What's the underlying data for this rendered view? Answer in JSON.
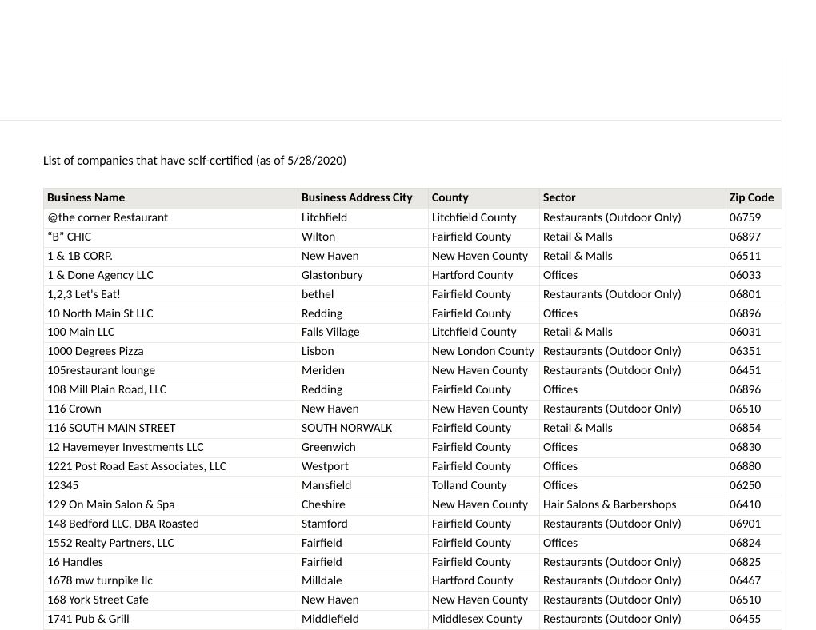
{
  "title": "List of companies that have self-certified (as of 5/28/2020)",
  "columns": {
    "name": "Business Name",
    "city": "Business Address City",
    "county": "County",
    "sector": "Sector",
    "zip": "Zip Code"
  },
  "rows": [
    {
      "name": "@the corner Restaurant",
      "city": "Litchfield",
      "county": "Litchfield County",
      "sector": "Restaurants (Outdoor Only)",
      "zip": "06759"
    },
    {
      "name": "“B” CHIC",
      "city": "Wilton",
      "county": "Fairfield County",
      "sector": "Retail & Malls",
      "zip": "06897"
    },
    {
      "name": "1 & 1B CORP.",
      "city": "New Haven",
      "county": "New Haven County",
      "sector": "Retail & Malls",
      "zip": "06511"
    },
    {
      "name": "1 & Done Agency LLC",
      "city": "Glastonbury",
      "county": "Hartford County",
      "sector": "Offices",
      "zip": "06033"
    },
    {
      "name": "1,2,3 Let's Eat!",
      "city": "bethel",
      "county": "Fairfield County",
      "sector": "Restaurants (Outdoor Only)",
      "zip": "06801"
    },
    {
      "name": "10 North Main St LLC",
      "city": "Redding",
      "county": "Fairfield County",
      "sector": "Offices",
      "zip": "06896"
    },
    {
      "name": "100 Main LLC",
      "city": "Falls Village",
      "county": "Litchfield County",
      "sector": "Retail & Malls",
      "zip": "06031"
    },
    {
      "name": "1000 Degrees Pizza",
      "city": "Lisbon",
      "county": "New London County",
      "sector": "Restaurants (Outdoor Only)",
      "zip": "06351"
    },
    {
      "name": "105restaurant lounge",
      "city": "Meriden",
      "county": "New Haven County",
      "sector": "Restaurants (Outdoor Only)",
      "zip": "06451"
    },
    {
      "name": "108 Mill Plain Road, LLC",
      "city": "Redding",
      "county": "Fairfield County",
      "sector": "Offices",
      "zip": "06896"
    },
    {
      "name": "116 Crown",
      "city": "New Haven",
      "county": "New Haven County",
      "sector": "Restaurants (Outdoor Only)",
      "zip": "06510"
    },
    {
      "name": "116 SOUTH MAIN STREET",
      "city": "SOUTH NORWALK",
      "county": "Fairfield County",
      "sector": "Retail & Malls",
      "zip": "06854"
    },
    {
      "name": "12 Havemeyer Investments LLC",
      "city": "Greenwich",
      "county": "Fairfield County",
      "sector": "Offices",
      "zip": "06830"
    },
    {
      "name": "1221 Post Road East Associates, LLC",
      "city": "Westport",
      "county": "Fairfield County",
      "sector": "Offices",
      "zip": "06880"
    },
    {
      "name": "12345",
      "city": "Mansfield",
      "county": "Tolland County",
      "sector": "Offices",
      "zip": "06250"
    },
    {
      "name": "129 On Main Salon & Spa",
      "city": "Cheshire",
      "county": "New Haven County",
      "sector": "Hair Salons & Barbershops",
      "zip": "06410"
    },
    {
      "name": "148 Bedford LLC, DBA Roasted",
      "city": "Stamford",
      "county": "Fairfield County",
      "sector": "Restaurants (Outdoor Only)",
      "zip": "06901"
    },
    {
      "name": "1552 Realty Partners, LLC",
      "city": "Fairfield",
      "county": "Fairfield County",
      "sector": "Offices",
      "zip": "06824"
    },
    {
      "name": "16 Handles",
      "city": "Fairfield",
      "county": "Fairfield County",
      "sector": "Restaurants (Outdoor Only)",
      "zip": "06825"
    },
    {
      "name": "1678 mw turnpike llc",
      "city": "Milldale",
      "county": "Hartford County",
      "sector": "Restaurants (Outdoor Only)",
      "zip": "06467"
    },
    {
      "name": "168 York Street Cafe",
      "city": "New Haven",
      "county": "New Haven County",
      "sector": "Restaurants (Outdoor Only)",
      "zip": "06510"
    },
    {
      "name": "1741 Pub & Grill",
      "city": "Middlefield",
      "county": "Middlesex County",
      "sector": "Restaurants (Outdoor Only)",
      "zip": "06455"
    }
  ]
}
